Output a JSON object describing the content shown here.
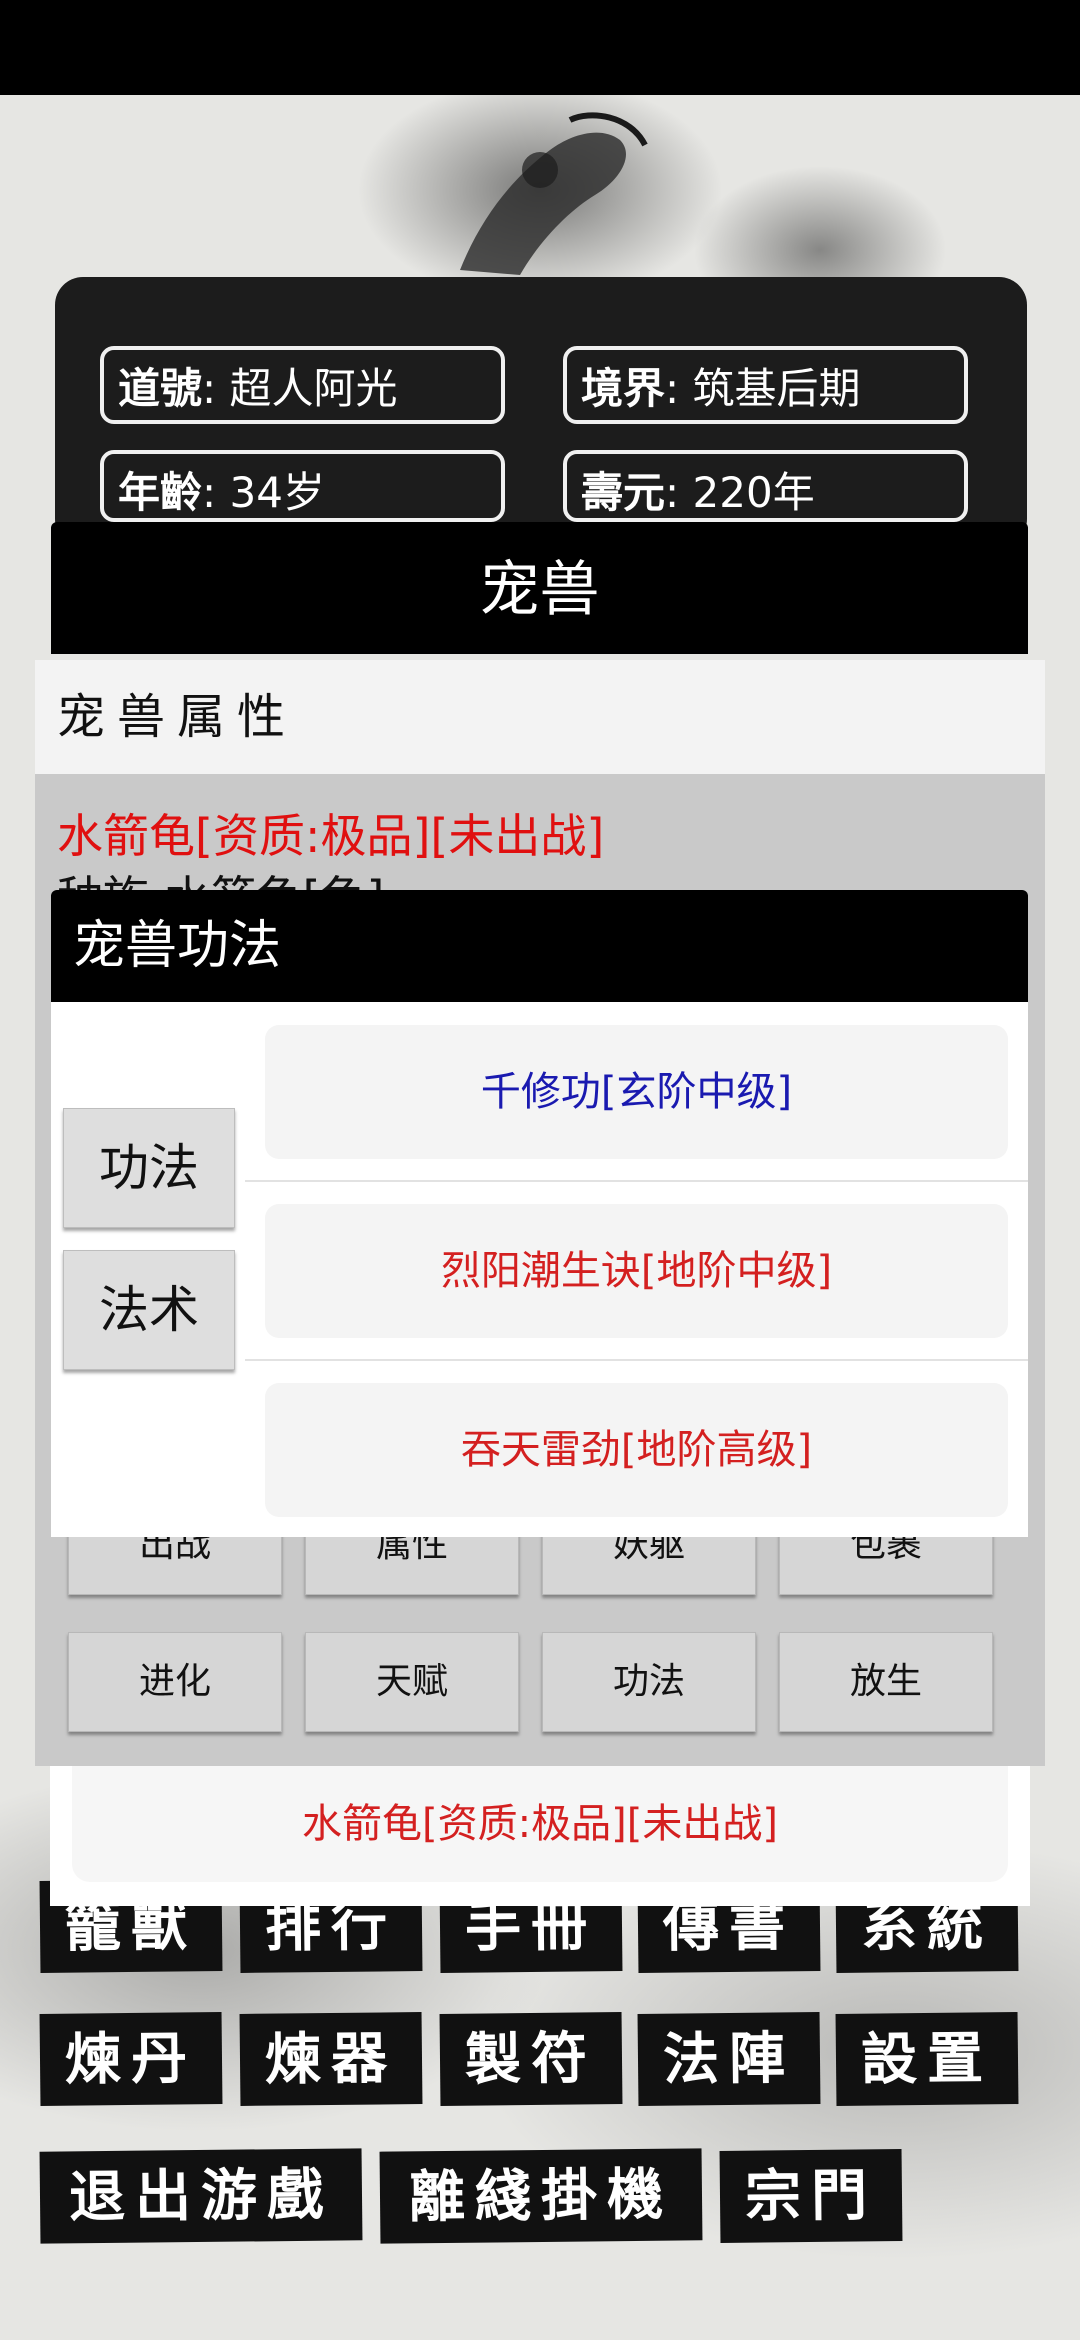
{
  "character": {
    "daohao_key": "道號",
    "daohao_value": "超人阿光",
    "realm_key": "境界",
    "realm_value": "筑基后期",
    "age_key": "年齡",
    "age_value": "34岁",
    "lifespan_key": "壽元",
    "lifespan_value": "220年"
  },
  "pet_dialog": {
    "title": "宠兽",
    "section_label": "宠兽属性",
    "pet_name": "水箭龟[资质:极品][未出战]",
    "species_partial": "种族:水箭龟[龟]",
    "actions_row1": [
      "出战",
      "属性",
      "妖躯",
      "包裹"
    ],
    "actions_row2": [
      "进化",
      "天赋",
      "功法",
      "放生"
    ],
    "bottom_pet": "水箭龟[资质:极品][未出战]"
  },
  "skill_dialog": {
    "title": "宠兽功法",
    "tabs": [
      "功法",
      "法术"
    ],
    "skills": [
      {
        "name": "千修功[玄阶中级]",
        "color": "#1a1ab0"
      },
      {
        "name": "烈阳潮生诀[地阶中级]",
        "color": "#d42020"
      },
      {
        "name": "吞天雷劲[地阶高级]",
        "color": "#d42020"
      }
    ]
  },
  "menu": {
    "row1": [
      "籠獸",
      "排行",
      "手冊",
      "傳書",
      "系統"
    ],
    "row2": [
      "煉丹",
      "煉器",
      "製符",
      "法陣",
      "設置"
    ],
    "row3": [
      "退出游戲",
      "離綫掛機",
      "宗門"
    ]
  },
  "colors": {
    "accent_red": "#e01010",
    "skill_blue": "#1a1ab0"
  }
}
